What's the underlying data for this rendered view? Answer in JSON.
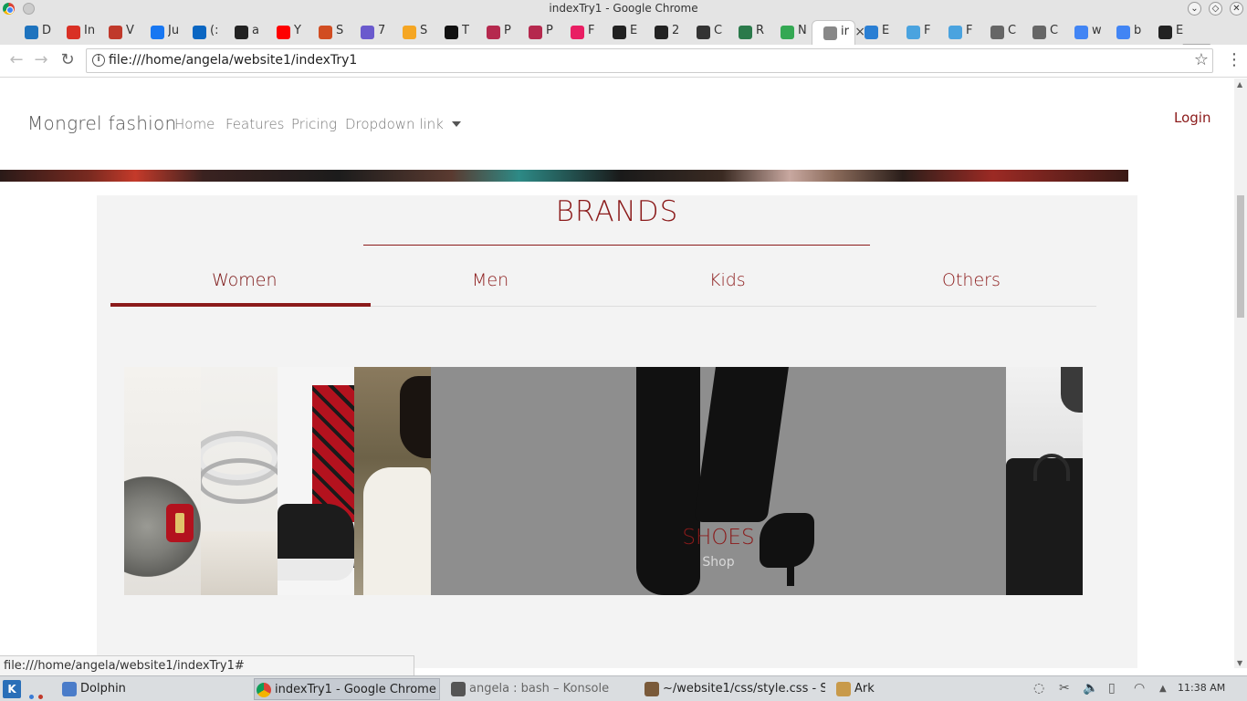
{
  "window": {
    "title": "indexTry1 - Google Chrome"
  },
  "tabs": [
    {
      "label": "D",
      "icon": "onedrive-icon",
      "color": "#1e73be"
    },
    {
      "label": "In",
      "icon": "gmail-icon",
      "color": "#d93025"
    },
    {
      "label": "V",
      "icon": "signature-icon",
      "color": "#c0392b"
    },
    {
      "label": "Ju",
      "icon": "facebook-icon",
      "color": "#1877f2"
    },
    {
      "label": "(:",
      "icon": "linkedin-icon",
      "color": "#0a66c2"
    },
    {
      "label": "a",
      "icon": "blackboard-icon",
      "color": "#222222"
    },
    {
      "label": "Y",
      "icon": "youtube-icon",
      "color": "#ff0000"
    },
    {
      "label": "S",
      "icon": "m-icon",
      "color": "#d14d22"
    },
    {
      "label": "7",
      "icon": "pocket-icon",
      "color": "#6a5acd"
    },
    {
      "label": "S",
      "icon": "asterisk-icon",
      "color": "#f5a623"
    },
    {
      "label": "T",
      "icon": "medium-icon",
      "color": "#111111"
    },
    {
      "label": "P",
      "icon": "pinterest-like-icon",
      "color": "#b5294e"
    },
    {
      "label": "P",
      "icon": "pinterest-like-icon",
      "color": "#b5294e"
    },
    {
      "label": "F",
      "icon": "pinwheel-icon",
      "color": "#e91e63"
    },
    {
      "label": "E",
      "icon": "diamond-icon",
      "color": "#222222"
    },
    {
      "label": "2",
      "icon": "f-icon",
      "color": "#222222"
    },
    {
      "label": "C",
      "icon": "codepen-icon",
      "color": "#333333"
    },
    {
      "label": "R",
      "icon": "codepen-icon",
      "color": "#2b7a4b"
    },
    {
      "label": "N",
      "icon": "maps-icon",
      "color": "#34a853"
    },
    {
      "label": "ir",
      "icon": "page-icon",
      "color": "#888888",
      "active": true
    },
    {
      "label": "E",
      "icon": "code-icon",
      "color": "#2a7fd4"
    },
    {
      "label": "F",
      "icon": "code-icon",
      "color": "#4aa3df"
    },
    {
      "label": "F",
      "icon": "code-icon",
      "color": "#4aa3df"
    },
    {
      "label": "C",
      "icon": "document-icon",
      "color": "#666666"
    },
    {
      "label": "C",
      "icon": "document-icon",
      "color": "#666666"
    },
    {
      "label": "w",
      "icon": "google-icon",
      "color": "#4285f4"
    },
    {
      "label": "b",
      "icon": "google-icon",
      "color": "#4285f4"
    },
    {
      "label": "E",
      "icon": "bold-b-icon",
      "color": "#222222"
    }
  ],
  "toolbar": {
    "url": "file:///home/angela/website1/indexTry1",
    "info_glyph": "i"
  },
  "site": {
    "brand": "Mongrel fashion",
    "nav": [
      "Home",
      "Features",
      "Pricing",
      "Dropdown link"
    ],
    "login": "Login",
    "section_title": "BRANDS",
    "brand_tabs": [
      "Women",
      "Men",
      "Kids",
      "Others"
    ],
    "active_tab": "Women",
    "slide": {
      "caption": "SHOES",
      "sub": "Shop"
    },
    "accent_color": "#8b1a1a"
  },
  "status_url": "file:///home/angela/website1/indexTry1#",
  "taskbar": {
    "items": [
      {
        "label": "Dolphin",
        "icon": "dolphin-icon"
      },
      {
        "label": "indexTry1 - Google Chrome",
        "icon": "chrome-icon",
        "active": true
      },
      {
        "label": "angela : bash – Konsole",
        "icon": "konsole-icon"
      },
      {
        "label": "~/website1/css/style.css - S",
        "icon": "editor-icon"
      },
      {
        "label": "Ark",
        "icon": "ark-icon"
      }
    ],
    "clock": "11:38 AM"
  }
}
